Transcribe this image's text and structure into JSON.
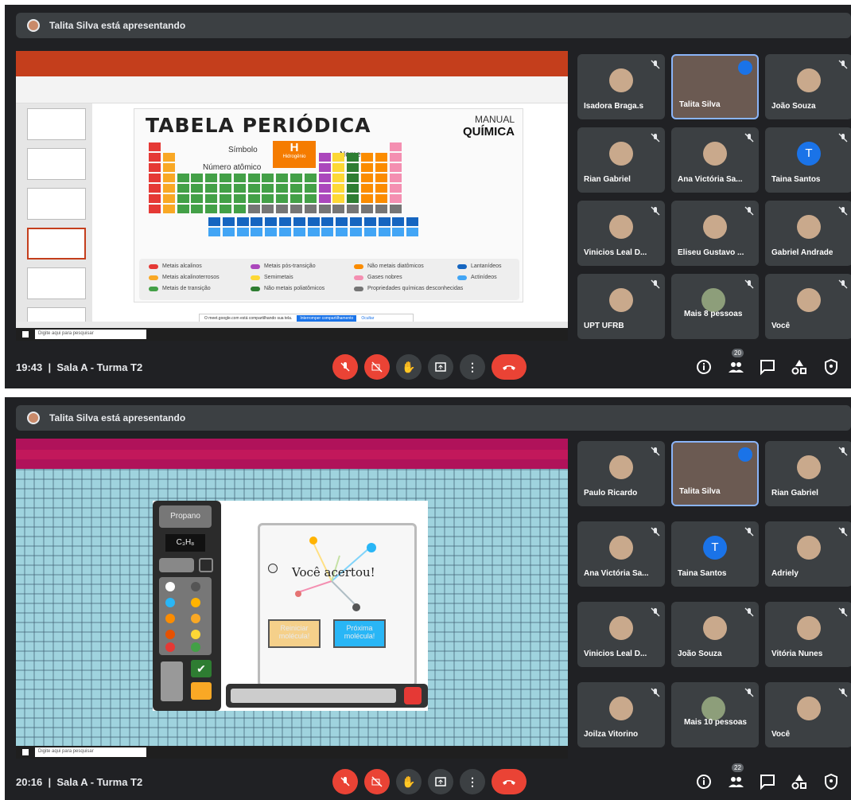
{
  "call1": {
    "presenter_banner": "Talita Silva está apresentando",
    "time": "19:43",
    "room": "Sala A - Turma T2",
    "participants_count": "20",
    "participants": [
      {
        "name": "Isadora Braga.s",
        "kind": "photo"
      },
      {
        "name": "Talita Silva",
        "kind": "video",
        "active": true
      },
      {
        "name": "João Souza",
        "kind": "photo"
      },
      {
        "name": "Rian Gabriel",
        "kind": "photo"
      },
      {
        "name": "Ana Victória Sa...",
        "kind": "photo"
      },
      {
        "name": "Taina Santos",
        "kind": "initial",
        "initial": "T"
      },
      {
        "name": "Vinicios Leal D...",
        "kind": "photo"
      },
      {
        "name": "Eliseu Gustavo ...",
        "kind": "photo"
      },
      {
        "name": "Gabriel Andrade",
        "kind": "photo"
      },
      {
        "name": "UPT UFRB",
        "kind": "photo"
      },
      {
        "name": "Mais 8 pessoas",
        "kind": "group"
      },
      {
        "name": "Você",
        "kind": "photo"
      }
    ],
    "slide": {
      "title": "TABELA PERIÓDICA",
      "manual": "MANUAL",
      "manual_sub": "QUÍMICA",
      "simbolo": "Símbolo",
      "nome": "Nome",
      "numero": "Número atômico",
      "hydrogen": "H",
      "hydrogen_name": "Hidrogênio",
      "legend": [
        {
          "label": "Metais alcalinos",
          "color": "#e53935"
        },
        {
          "label": "Metais alcalinoterrosos",
          "color": "#f9a825"
        },
        {
          "label": "Metais de transição",
          "color": "#43a047"
        },
        {
          "label": "Metais pós-transição",
          "color": "#ab47bc"
        },
        {
          "label": "Semimetais",
          "color": "#fdd835"
        },
        {
          "label": "Não metais poliatômicos",
          "color": "#2e7d32"
        },
        {
          "label": "Não metais diatômicos",
          "color": "#fb8c00"
        },
        {
          "label": "Gases nobres",
          "color": "#f48fb1"
        },
        {
          "label": "Propriedades químicas desconhecidas",
          "color": "#757575"
        },
        {
          "label": "Lantanídeos",
          "color": "#1565c0"
        },
        {
          "label": "Actinídeos",
          "color": "#42a5f5"
        }
      ],
      "share_notice": "O meet.google.com está compartilhando sua tela.",
      "share_stop": "Interromper compartilhamento",
      "share_hide": "Ocultar",
      "search": "Digite aqui para pesquisar"
    }
  },
  "call2": {
    "presenter_banner": "Talita Silva está apresentando",
    "time": "20:16",
    "room": "Sala A - Turma T2",
    "participants_count": "22",
    "participants": [
      {
        "name": "Paulo Ricardo",
        "kind": "photo"
      },
      {
        "name": "Talita Silva",
        "kind": "video",
        "active": true
      },
      {
        "name": "Rian Gabriel",
        "kind": "photo"
      },
      {
        "name": "Ana Victória Sa...",
        "kind": "photo"
      },
      {
        "name": "Taina Santos",
        "kind": "initial",
        "initial": "T"
      },
      {
        "name": "Adriely",
        "kind": "photo"
      },
      {
        "name": "Vinicios Leal D...",
        "kind": "photo"
      },
      {
        "name": "João Souza",
        "kind": "photo"
      },
      {
        "name": "Vitória Nunes",
        "kind": "photo"
      },
      {
        "name": "Joilza Vitorino",
        "kind": "photo"
      },
      {
        "name": "Mais 10 pessoas",
        "kind": "group"
      },
      {
        "name": "Você",
        "kind": "photo"
      }
    ],
    "game": {
      "molecule": "Propano",
      "formula": "C₃H₈",
      "message": "Você acertou!",
      "restart": "Reiniciar molécula!",
      "next": "Próxima molécula!",
      "search": "Digite aqui para pesquisar"
    }
  }
}
